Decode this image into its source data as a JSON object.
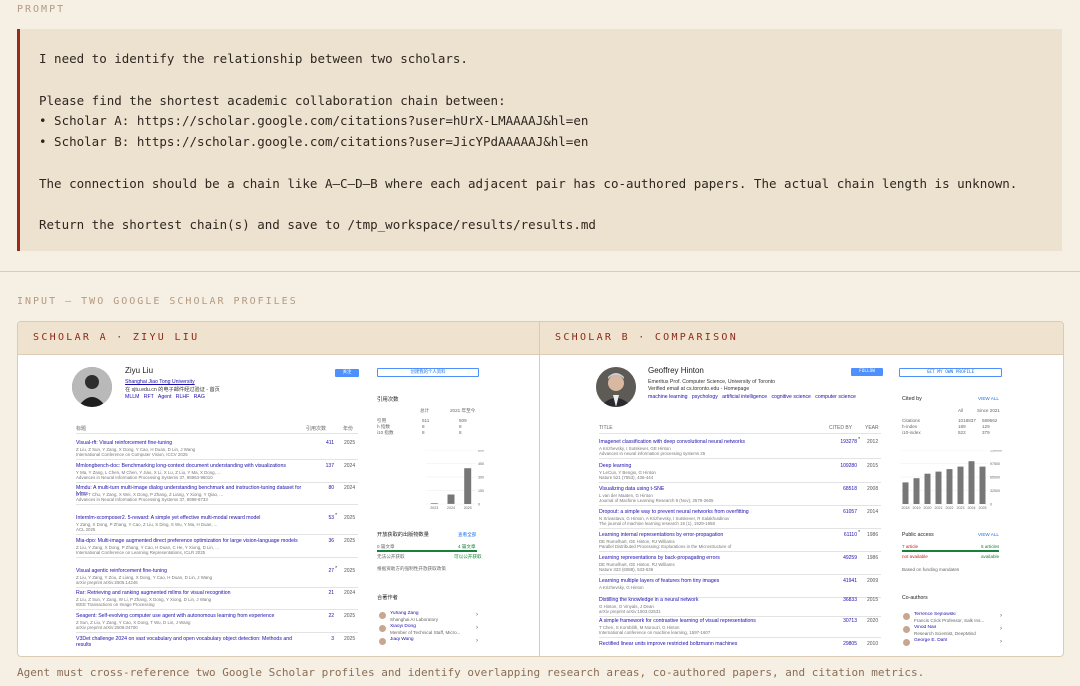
{
  "labels": {
    "prompt": "PROMPT",
    "input": "INPUT — TWO GOOGLE SCHOLAR PROFILES",
    "footer": "Agent must cross-reference two Google Scholar profiles and identify overlapping research areas, co-authored papers, and citation metrics."
  },
  "prompt_lines": [
    "I need to identify the relationship between two scholars.",
    "",
    "Please find the shortest academic collaboration chain between:",
    "• Scholar A: https://scholar.google.com/citations?user=hUrX-LMAAAAJ&hl=en",
    "• Scholar B: https://scholar.google.com/citations?user=JicYPdAAAAAJ&hl=en",
    "",
    "The connection should be a chain like A–C–D–B where each adjacent pair has co-authored papers. The actual chain length is unknown.",
    "",
    "Return the shortest chain(s) and save to /tmp_workspace/results/results.md"
  ],
  "colors": {
    "accent": "#9a2a1c",
    "background": "#f5efe4",
    "panel_header": "#efe3cf",
    "link": "#1a0dab"
  },
  "scholar_a": {
    "header": "SCHOLAR A · ZIYU LIU",
    "name": "Ziyu Liu",
    "affiliation": "Shanghai Jiao Tong University",
    "email": "在 sjtu.edu.cn 的电子邮件经过验证 - 首页",
    "interests": [
      "MLLM",
      "RFT",
      "Agent",
      "RLHF",
      "RAG"
    ],
    "follow_label": "关注",
    "profile_button": "创建我的个人资料",
    "cols": {
      "title": "标题",
      "cited": "引用次数",
      "year": "年份"
    },
    "cited_by_title": "引用次数",
    "stats_head": [
      "",
      "总计",
      "2021 年至今"
    ],
    "stats": [
      [
        "引用",
        "511",
        "509"
      ],
      [
        "h 指数",
        "8",
        "8"
      ],
      [
        "i10 指数",
        "8",
        "8"
      ]
    ],
    "chart_years": [
      "2023",
      "2024",
      "2025"
    ],
    "chart_ticks": [
      "600",
      "450",
      "300",
      "150",
      "0"
    ],
    "public_access_title": "开放获取的出版物数量",
    "public_access_more": "查看全部",
    "public_access_rows": [
      [
        "0 篇文章",
        "4 篇文章"
      ],
      [
        "无法公开获取",
        "可以公开获取"
      ]
    ],
    "public_access_note": "根据资助方的强制性开放获取政策",
    "coauthors_title": "合著作者",
    "coauthors": [
      {
        "name": "Yuhang Zang",
        "aff": "Shanghai AI Laboratory"
      },
      {
        "name": "Xiaoyi Dong",
        "aff": "Member of Technical Staff, Micro..."
      },
      {
        "name": "Jiaqi Wang",
        "aff": ""
      }
    ],
    "papers": [
      {
        "title": "Visual-rft: Visual reinforcement fine-tuning",
        "authors": "Z Liu, Z Sun, Y Zang, X Dong, Y Cao, H Duan, D Lin, J Wang",
        "venue": "International Conference on Computer Vision, ICCV 2025",
        "cited": "411",
        "year": "2025",
        "star": ""
      },
      {
        "title": "Mmlongbench-doc: Benchmarking long-context document understanding with visualizations",
        "authors": "Y Ma, Y Zang, L Chen, M Chen, Y Jiao, X Li, X Lu, Z Liu, Y Ma, X Dong, ...",
        "venue": "Advances in Neural Information Processing Systems 37, 95963-96010",
        "cited": "137",
        "year": "2024",
        "star": ""
      },
      {
        "title": "Mmdu: A multi-turn multi-image dialog understanding benchmark and instruction-tuning dataset for lvlms",
        "authors": "Z Liu, T Chu, Y Zang, X Wei, X Dong, P Zhang, Z Liang, Y Xiong, Y Qiao, ...",
        "venue": "Advances in Neural Information Processing Systems 37, 8698-8733",
        "cited": "80",
        "year": "2024",
        "star": ""
      },
      {
        "title": "Internlm-xcomposer2. 5-reward: A simple yet effective multi-modal reward model",
        "authors": "Y Zang, X Dong, P Zhang, Y Cao, Z Liu, S Ding, S Wu, Y Ma, H Duan, ...",
        "venue": "ACL 2025",
        "cited": "53",
        "year": "2025",
        "star": "*"
      },
      {
        "title": "Mia-dpo: Multi-image augmented direct preference optimization for large vision-language models",
        "authors": "Z Liu, Y Zang, X Dong, P Zhang, Y Cao, H Duan, C He, Y Xiong, D Lin, ...",
        "venue": "International Conference on Learning Representations, ICLR 2025",
        "cited": "36",
        "year": "2025",
        "star": ""
      },
      {
        "title": "Visual agentic reinforcement fine-tuning",
        "authors": "Z Liu, Y Zang, Y Zou, Z Liang, X Dong, Y Cao, H Duan, D Lin, J Wang",
        "venue": "arXiv preprint arXiv:2505.14246",
        "cited": "27",
        "year": "2025",
        "star": "*"
      },
      {
        "title": "Rar: Retrieving and ranking augmented mllms for visual recognition",
        "authors": "Z Liu, Z Sun, Y Zang, W Li, P Zhang, X Dong, Y Xiong, D Lin, J Wang",
        "venue": "IEEE Transactions on Image Processing",
        "cited": "21",
        "year": "2024",
        "star": ""
      },
      {
        "title": "Seagent: Self-evolving computer use agent with autonomous learning from experience",
        "authors": "Z Sun, Z Liu, Y Zang, Y Cao, X Dong, T Wu, D Lin, J Wang",
        "venue": "arXiv preprint arXiv:2508.04700",
        "cited": "22",
        "year": "2025",
        "star": ""
      },
      {
        "title": "V3Det challenge 2024 on vast vocabulary and open vocabulary object detection: Methods and results",
        "authors": "",
        "venue": "",
        "cited": "3",
        "year": "2025",
        "star": ""
      }
    ]
  },
  "scholar_b": {
    "header": "SCHOLAR B · COMPARISON",
    "name": "Geoffrey Hinton",
    "affiliation": "Emeritus Prof. Computer Science, University of Toronto",
    "email": "Verified email at cs.toronto.edu - Homepage",
    "interests": [
      "machine learning",
      "psychology",
      "artificial intelligence",
      "cognitive science",
      "computer science"
    ],
    "follow_label": "FOLLOW",
    "profile_button": "GET MY OWN PROFILE",
    "cols": {
      "title": "TITLE",
      "cited": "CITED BY",
      "year": "YEAR"
    },
    "cited_by_title": "Cited by",
    "view_all": "VIEW ALL",
    "stats_head": [
      "",
      "All",
      "Since 2021"
    ],
    "stats": [
      [
        "Citations",
        "1018837",
        "589662"
      ],
      [
        "h-index",
        "189",
        "129"
      ],
      [
        "i10-index",
        "522",
        "379"
      ]
    ],
    "chart_years": [
      "2018",
      "2019",
      "2020",
      "2021",
      "2022",
      "2023",
      "2024",
      "2025"
    ],
    "chart_ticks": [
      "130000",
      "97500",
      "65000",
      "32500",
      "0"
    ],
    "public_access_title": "Public access",
    "public_access_rows": [
      [
        "7 article",
        "5 articles"
      ],
      [
        "not available",
        "available"
      ]
    ],
    "public_access_note": "Based on funding mandates",
    "coauthors_title": "Co-authors",
    "coauthors": [
      {
        "name": "Terrence Sejnowski",
        "aff": "Francis Crick Professor, Salk Ins..."
      },
      {
        "name": "Vinod Nair",
        "aff": "Research Scientist, DeepMind"
      },
      {
        "name": "George E. Dahl",
        "aff": ""
      }
    ],
    "papers": [
      {
        "title": "Imagenet classification with deep convolutional neural networks",
        "authors": "A Krizhevsky, I Sutskever, GE Hinton",
        "venue": "Advances in neural information processing systems 25",
        "cited": "193278",
        "year": "2012",
        "star": "*"
      },
      {
        "title": "Deep learning",
        "authors": "Y LeCun, Y Bengio, G Hinton",
        "venue": "Nature 521 (7553), 436-444",
        "cited": "109280",
        "year": "2015",
        "star": ""
      },
      {
        "title": "Visualizing data using t-SNE",
        "authors": "L van der Maaten, G Hinton",
        "venue": "Journal of Machine Learning Research 9 (Nov), 2579-2605",
        "cited": "68518",
        "year": "2008",
        "star": ""
      },
      {
        "title": "Dropout: a simple way to prevent neural networks from overfitting",
        "authors": "N Srivastava, G Hinton, A Krizhevsky, I Sutskever, R Salakhutdinov",
        "venue": "The journal of machine learning research 15 (1), 1929-1958",
        "cited": "61057",
        "year": "2014",
        "star": ""
      },
      {
        "title": "Learning internal representations by error-propagation",
        "authors": "DE Rumelhart, GE Hinton, RJ Williams",
        "venue": "Parallel Distributed Processing: Explorations in the Microstructure of",
        "cited": "61110",
        "year": "1986",
        "star": "*"
      },
      {
        "title": "Learning representations by back-propagating errors",
        "authors": "DE Rumelhart, GE Hinton, RJ Williams",
        "venue": "Nature 323 (6088), 533-536",
        "cited": "49259",
        "year": "1986",
        "star": ""
      },
      {
        "title": "Learning multiple layers of features from tiny images",
        "authors": "A Krizhevsky, G Hinton",
        "venue": "",
        "cited": "41941",
        "year": "2009",
        "star": ""
      },
      {
        "title": "Distilling the knowledge in a neural network",
        "authors": "G Hinton, O Vinyals, J Dean",
        "venue": "arXiv preprint arXiv:1503.02531",
        "cited": "36833",
        "year": "2015",
        "star": ""
      },
      {
        "title": "A simple framework for contrastive learning of visual representations",
        "authors": "T Chen, S Kornblith, M Norouzi, G Hinton",
        "venue": "International conference on machine learning, 1597-1607",
        "cited": "30713",
        "year": "2020",
        "star": ""
      },
      {
        "title": "Rectified linear units improve restricted boltzmann machines",
        "authors": "",
        "venue": "",
        "cited": "29805",
        "year": "2010",
        "star": ""
      }
    ]
  },
  "chart_data": [
    {
      "type": "bar",
      "categories": [
        "2023",
        "2024",
        "2025"
      ],
      "values": [
        8,
        105,
        398
      ],
      "ylim": [
        0,
        600
      ]
    },
    {
      "type": "bar",
      "categories": [
        "2018",
        "2019",
        "2020",
        "2021",
        "2022",
        "2023",
        "2024",
        "2025"
      ],
      "values": [
        52000,
        62000,
        73000,
        78000,
        84000,
        90000,
        103000,
        90000
      ],
      "ylim": [
        0,
        130000
      ]
    }
  ]
}
